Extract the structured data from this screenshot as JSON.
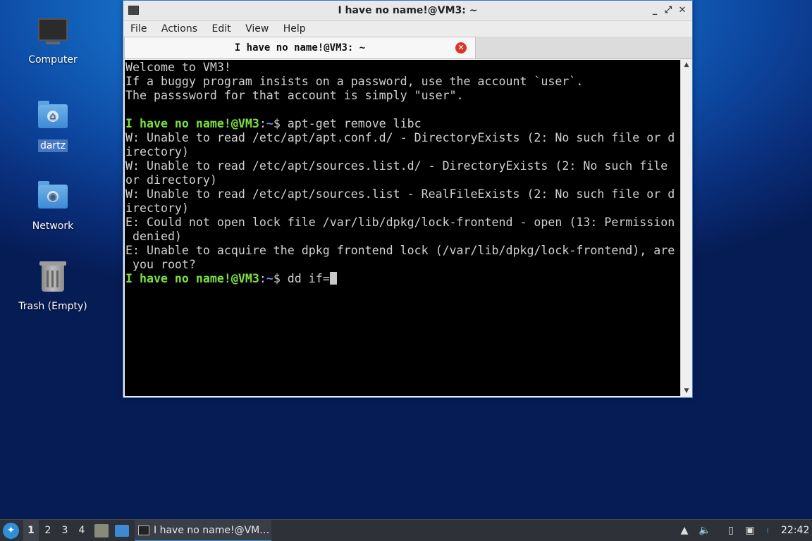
{
  "desktop": {
    "icons": [
      {
        "label": "Computer"
      },
      {
        "label": "dartz"
      },
      {
        "label": "Network"
      },
      {
        "label": "Trash (Empty)"
      }
    ]
  },
  "window": {
    "title": "I have no name!@VM3: ~",
    "buttons": {
      "minimize": "_",
      "maximize": "⤢",
      "close": "✕"
    },
    "menu": [
      "File",
      "Actions",
      "Edit",
      "View",
      "Help"
    ],
    "tab": {
      "label": "I have no name!@VM3: ~",
      "close": "✕"
    }
  },
  "terminal": {
    "lines": [
      "Welcome to VM3!",
      "If a buggy program insists on a password, use the account `user`.",
      "The passsword for that account is simply \"user\".",
      "",
      {
        "user": "I have no name!@VM3",
        "sep": ":",
        "path": "~",
        "cmd": "$ apt-get remove libc"
      },
      "W: Unable to read /etc/apt/apt.conf.d/ - DirectoryExists (2: No such file or d",
      "irectory)",
      "W: Unable to read /etc/apt/sources.list.d/ - DirectoryExists (2: No such file",
      "or directory)",
      "W: Unable to read /etc/apt/sources.list - RealFileExists (2: No such file or d",
      "irectory)",
      "E: Could not open lock file /var/lib/dpkg/lock-frontend - open (13: Permission",
      " denied)",
      "E: Unable to acquire the dpkg frontend lock (/var/lib/dpkg/lock-frontend), are",
      " you root?",
      {
        "user": "I have no name!@VM3",
        "sep": ":",
        "path": "~",
        "cmd": "$ dd if=",
        "cursor": true
      }
    ]
  },
  "taskbar": {
    "start_icon": "start-menu-icon",
    "workspaces": [
      "1",
      "2",
      "3",
      "4"
    ],
    "active_workspace": "1",
    "task_label": "I have no name!@VM…",
    "tray_icons": [
      "expand-tray-icon",
      "volume-icon",
      "clipboard-icon",
      "network-icon",
      "notification-icon"
    ],
    "notification_badge": "!",
    "clock": "22:42"
  }
}
